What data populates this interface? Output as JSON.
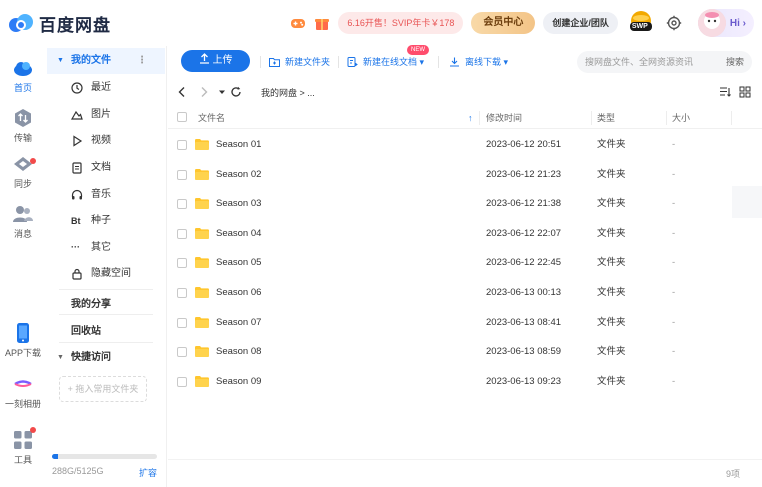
{
  "header": {
    "logo_text": "百度网盘",
    "promo_text": "6.16开售！SVIP年卡￥178",
    "vip_label": "会员中心",
    "biz_label": "创建企业/团队",
    "swp_label": "SWP",
    "hi_label": "Hi ›"
  },
  "rail": {
    "items": [
      {
        "label": "首页"
      },
      {
        "label": "传输"
      },
      {
        "label": "同步"
      },
      {
        "label": "消息"
      },
      {
        "label": "APP下载"
      },
      {
        "label": "一刻相册"
      },
      {
        "label": "工具"
      }
    ]
  },
  "sidebar": {
    "my_files": "我的文件",
    "more": "⋮",
    "items": [
      {
        "label": "最近",
        "icon": "clock-icon"
      },
      {
        "label": "图片",
        "icon": "image-icon"
      },
      {
        "label": "视频",
        "icon": "play-icon"
      },
      {
        "label": "文档",
        "icon": "doc-icon"
      },
      {
        "label": "音乐",
        "icon": "headphone-icon"
      },
      {
        "label": "种子",
        "icon": "bt-icon",
        "glyph": "Bt"
      },
      {
        "label": "其它",
        "icon": "more-icon",
        "glyph": "···"
      },
      {
        "label": "隐藏空间",
        "icon": "lock-icon"
      }
    ],
    "my_share": "我的分享",
    "recycle": "回收站",
    "quick_access": "快捷访问",
    "add_quick": "+ 拖入常用文件夹",
    "storage_text": "288G/5125G",
    "storage_fraction": 0.056,
    "expand_label": "扩容"
  },
  "toolbar": {
    "upload_label": "上传",
    "new_folder": "新建文件夹",
    "new_online_doc": "新建在线文档 ▾",
    "new_badge": "NEW",
    "offline_download": "离线下载 ▾",
    "search_placeholder": "搜网盘文件、全网资源资讯",
    "search_label": "搜索"
  },
  "nav": {
    "breadcrumb": "我的网盘    >    ..."
  },
  "table": {
    "headers": {
      "name": "文件名",
      "sort": "↑",
      "time": "修改时间",
      "type": "类型",
      "size": "大小"
    },
    "rows": [
      {
        "name": "Season 01",
        "time": "2023-06-12 20:51",
        "type": "文件夹",
        "size": "-"
      },
      {
        "name": "Season 02",
        "time": "2023-06-12 21:23",
        "type": "文件夹",
        "size": "-"
      },
      {
        "name": "Season 03",
        "time": "2023-06-12 21:38",
        "type": "文件夹",
        "size": "-"
      },
      {
        "name": "Season 04",
        "time": "2023-06-12 22:07",
        "type": "文件夹",
        "size": "-"
      },
      {
        "name": "Season 05",
        "time": "2023-06-12 22:45",
        "type": "文件夹",
        "size": "-"
      },
      {
        "name": "Season 06",
        "time": "2023-06-13 00:13",
        "type": "文件夹",
        "size": "-"
      },
      {
        "name": "Season 07",
        "time": "2023-06-13 08:41",
        "type": "文件夹",
        "size": "-"
      },
      {
        "name": "Season 08",
        "time": "2023-06-13 08:59",
        "type": "文件夹",
        "size": "-"
      },
      {
        "name": "Season 09",
        "time": "2023-06-13 09:23",
        "type": "文件夹",
        "size": "-"
      }
    ]
  },
  "footer": {
    "count": "9项"
  },
  "colors": {
    "accent": "#1b74e8",
    "folder": "#ffc62e",
    "promo": "#e85454"
  }
}
